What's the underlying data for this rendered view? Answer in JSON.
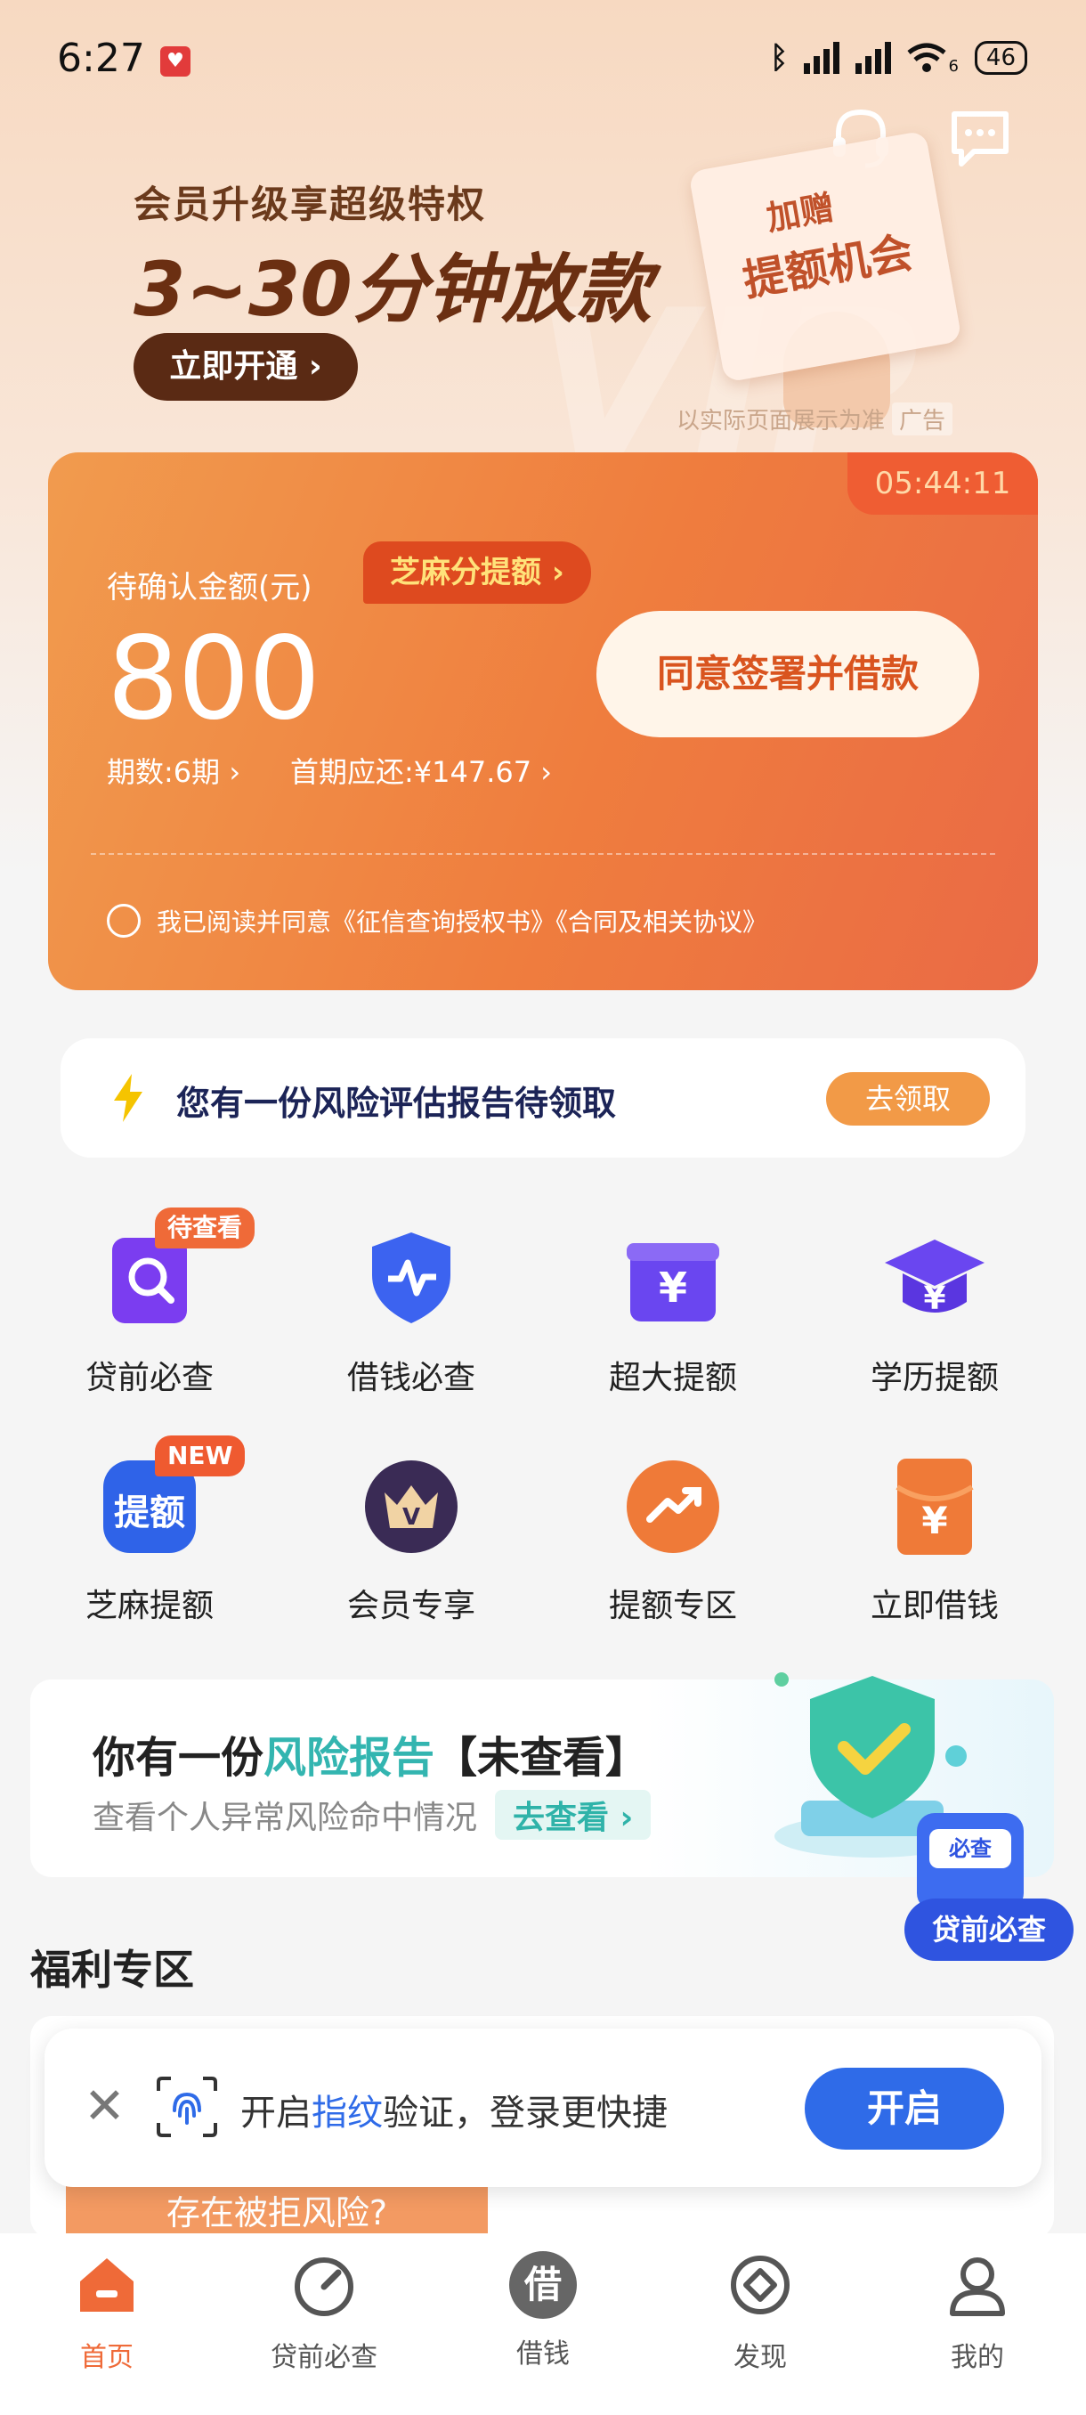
{
  "status_bar": {
    "time": "6:27",
    "network_suffix": "6",
    "battery": "46"
  },
  "banner": {
    "subtitle": "会员升级享超级特权",
    "headline": "3~30分钟放款",
    "cta_label": "立即开通 ›",
    "gift_line1": "加赠",
    "gift_line2": "提额机会",
    "watermark": "VIP",
    "disclaimer": "以实际页面展示为准",
    "ad_tag": "广告"
  },
  "loan_card": {
    "countdown": "05:44:11",
    "pending_label": "待确认金额(元)",
    "zhima_badge": "芝麻分提额 ›",
    "amount": "800",
    "period": "期数:6期 ›",
    "first_payment": "首期应还:¥147.67 ›",
    "agree_button": "同意签署并借款",
    "consent_text": "我已阅读并同意《征信查询授权书》《合同及相关协议》"
  },
  "risk_bar": {
    "text": "您有一份风险评估报告待领取",
    "button": "去领取"
  },
  "grid": {
    "items": [
      {
        "label": "贷前必查",
        "badge": "待查看",
        "icon": "search-doc-icon"
      },
      {
        "label": "借钱必查",
        "icon": "shield-pulse-icon"
      },
      {
        "label": "超大提额",
        "icon": "gift-yuan-icon"
      },
      {
        "label": "学历提额",
        "icon": "graduation-cap-icon"
      },
      {
        "label": "芝麻提额",
        "badge": "NEW",
        "icon": "tie-e-icon",
        "icon_text": "提额"
      },
      {
        "label": "会员专享",
        "icon": "vip-crown-icon"
      },
      {
        "label": "提额专区",
        "icon": "trend-up-icon"
      },
      {
        "label": "立即借钱",
        "icon": "red-envelope-icon"
      }
    ]
  },
  "report_card": {
    "title_pre": "你有一份",
    "title_highlight": "风险报告",
    "title_post": "【未查看】",
    "subtitle": "查看个人异常风险命中情况",
    "go_label": "去查看 ›",
    "phone_label": "必查"
  },
  "float_button": "贷前必查",
  "welfare": {
    "title": "福利专区",
    "card_text": "存在被拒风险?"
  },
  "fingerprint_toast": {
    "text_pre": "开启",
    "text_highlight": "指纹",
    "text_post": "验证，登录更快捷",
    "button": "开启"
  },
  "tabbar": {
    "items": [
      {
        "label": "首页",
        "active": true
      },
      {
        "label": "贷前必查"
      },
      {
        "label": "借钱",
        "icon_char": "借"
      },
      {
        "label": "发现"
      },
      {
        "label": "我的"
      }
    ]
  },
  "colors": {
    "accent_orange": "#ef6a38",
    "brand_blue": "#2f6be8",
    "teal": "#33b5b0"
  }
}
